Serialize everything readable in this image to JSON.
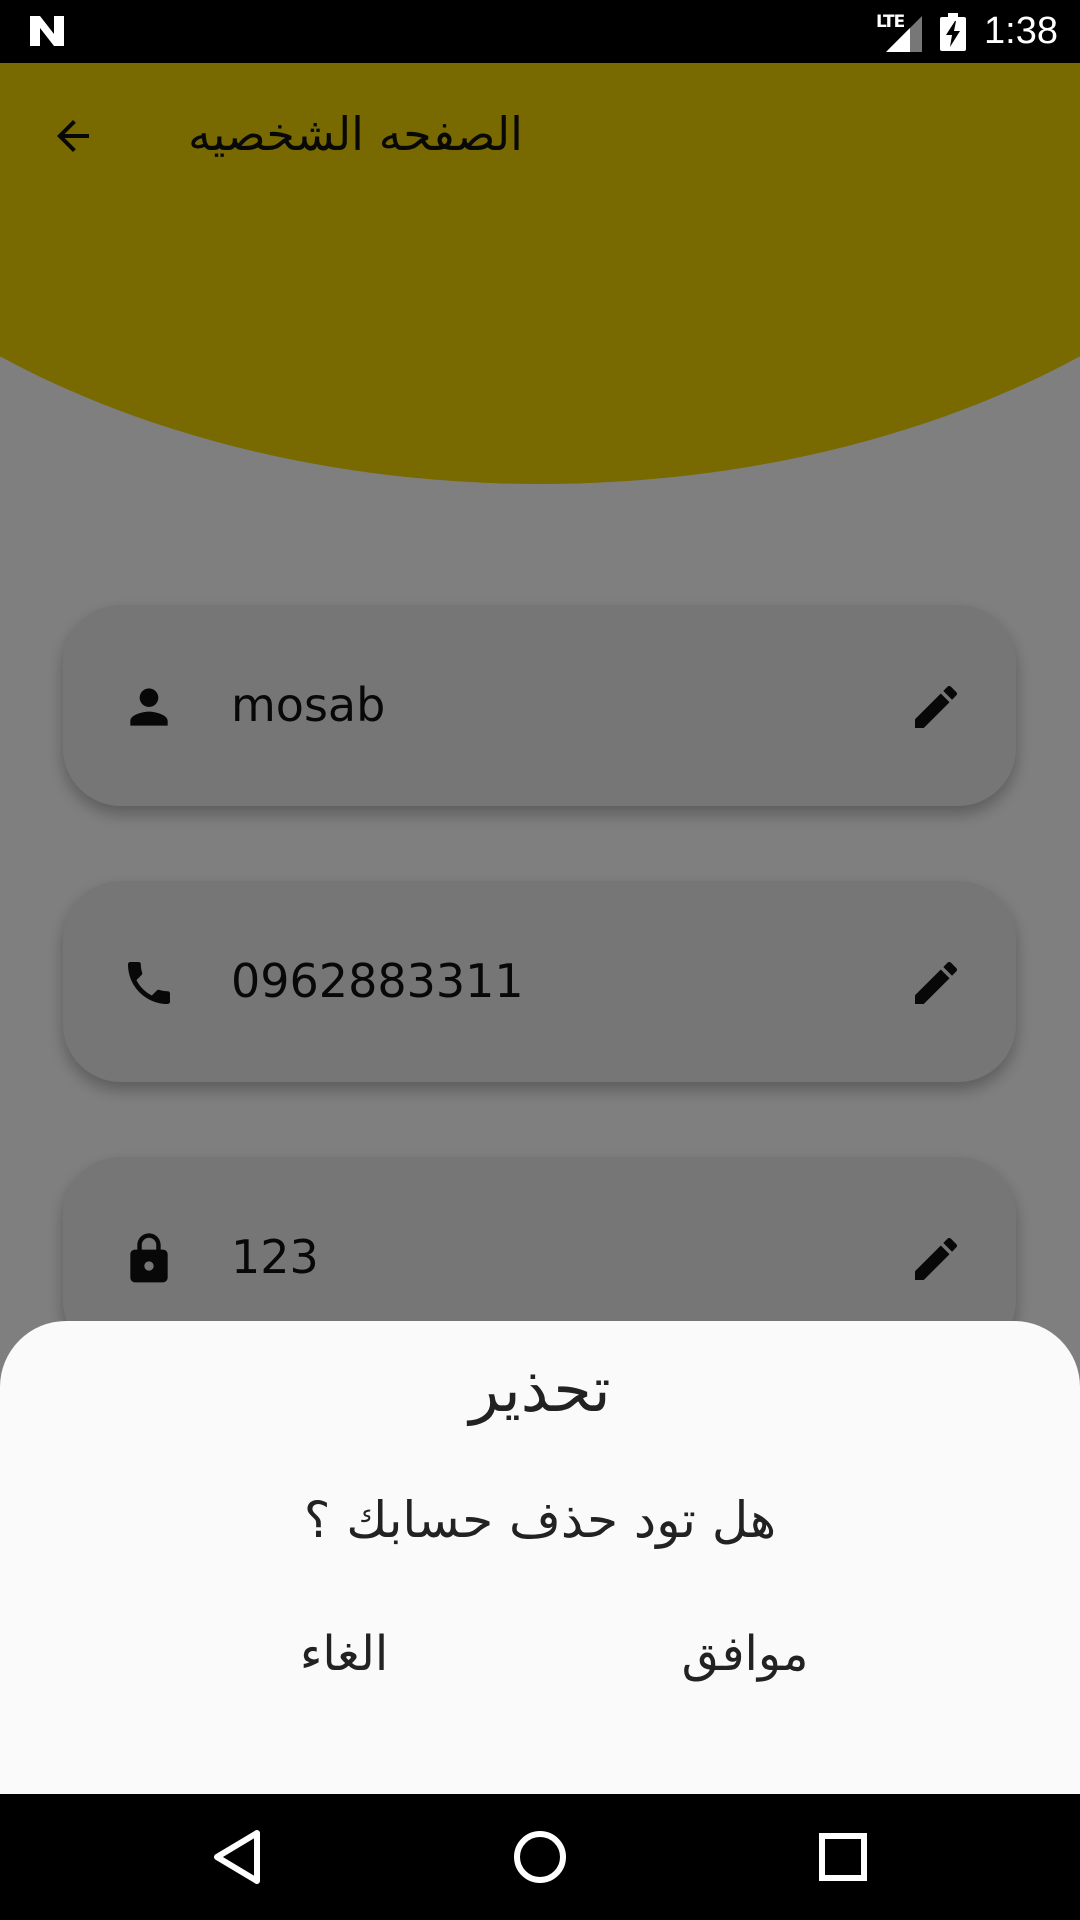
{
  "status_bar": {
    "time": "1:38",
    "network_label": "LTE"
  },
  "app_bar": {
    "title": "الصفحه الشخصيه",
    "back_icon": "arrow-back-icon"
  },
  "profile_fields": [
    {
      "icon": "person-icon",
      "value": "mosab"
    },
    {
      "icon": "phone-icon",
      "value": "0962883311"
    },
    {
      "icon": "lock-icon",
      "value": "123"
    }
  ],
  "dialog": {
    "title": "تحذير",
    "message": "هل تود حذف حسابك ؟",
    "confirm_label": "موافق",
    "cancel_label": "الغاء"
  },
  "colors": {
    "header": "#f0d500",
    "card": "#ededed",
    "sheet": "#fafafa"
  }
}
